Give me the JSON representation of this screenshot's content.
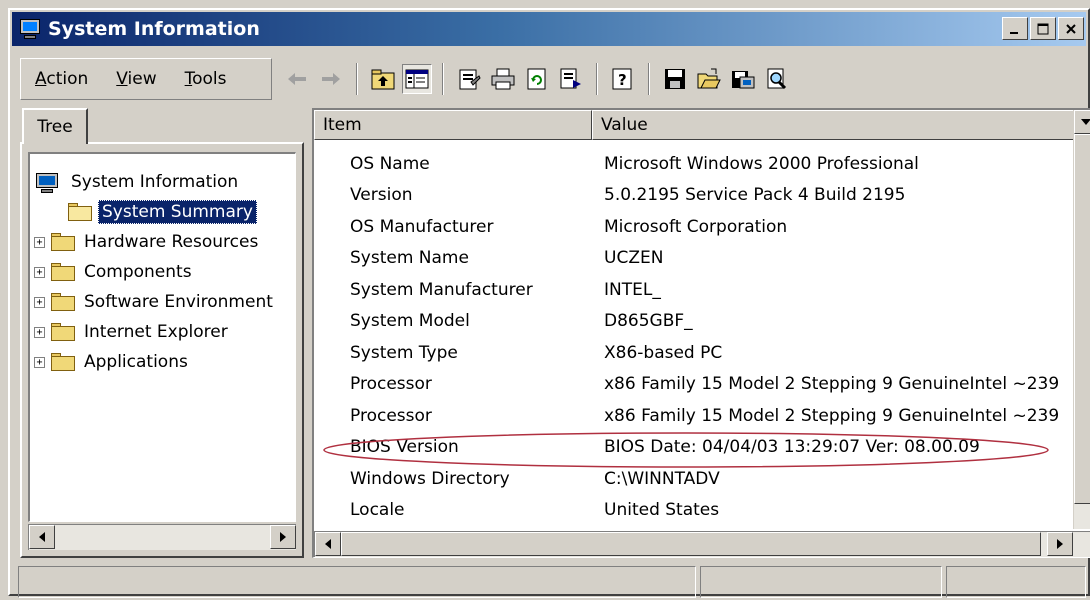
{
  "window": {
    "title": "System Information",
    "buttons": [
      "minimize",
      "maximize",
      "close"
    ]
  },
  "menu": {
    "items": [
      {
        "label": "Action",
        "accel": "A",
        "rest": "ction"
      },
      {
        "label": "View",
        "accel": "V",
        "rest": "iew"
      },
      {
        "label": "Tools",
        "accel": "T",
        "rest": "ools"
      }
    ]
  },
  "toolbar": {
    "icons": [
      "back-arrow-icon",
      "forward-arrow-icon",
      "up-one-level-icon",
      "show-hide-tree-icon",
      "properties-icon",
      "print-icon",
      "refresh-icon",
      "export-list-icon",
      "help-icon",
      "save-icon",
      "open-icon",
      "save-system-info-icon",
      "find-icon"
    ]
  },
  "tree": {
    "tab_label": "Tree",
    "root": "System Information",
    "items": [
      {
        "label": "System Summary",
        "selected": true,
        "expandable": false
      },
      {
        "label": "Hardware Resources",
        "selected": false,
        "expandable": true
      },
      {
        "label": "Components",
        "selected": false,
        "expandable": true
      },
      {
        "label": "Software Environment",
        "selected": false,
        "expandable": true
      },
      {
        "label": "Internet Explorer",
        "selected": false,
        "expandable": true
      },
      {
        "label": "Applications",
        "selected": false,
        "expandable": true
      }
    ]
  },
  "list": {
    "columns": {
      "item": "Item",
      "value": "Value"
    },
    "rows": [
      {
        "item": "OS Name",
        "value": "Microsoft Windows 2000 Professional"
      },
      {
        "item": "Version",
        "value": "5.0.2195 Service Pack 4 Build 2195"
      },
      {
        "item": "OS Manufacturer",
        "value": "Microsoft Corporation"
      },
      {
        "item": "System Name",
        "value": "UCZEN"
      },
      {
        "item": "System Manufacturer",
        "value": "INTEL_"
      },
      {
        "item": "System Model",
        "value": "D865GBF_"
      },
      {
        "item": "System Type",
        "value": "X86-based PC"
      },
      {
        "item": "Processor",
        "value": "x86 Family 15 Model 2 Stepping 9 GenuineIntel ~239"
      },
      {
        "item": "Processor",
        "value": "x86 Family 15 Model 2 Stepping 9 GenuineIntel ~239"
      },
      {
        "item": "BIOS Version",
        "value": "BIOS Date: 04/04/03 13:29:07 Ver: 08.00.09"
      },
      {
        "item": "Windows Directory",
        "value": "C:\\WINNTADV"
      },
      {
        "item": "Locale",
        "value": "United States"
      }
    ],
    "highlighted_row": "BIOS Version",
    "highlight_color": "#b03040"
  },
  "status": {
    "panels": [
      "",
      "",
      ""
    ]
  }
}
